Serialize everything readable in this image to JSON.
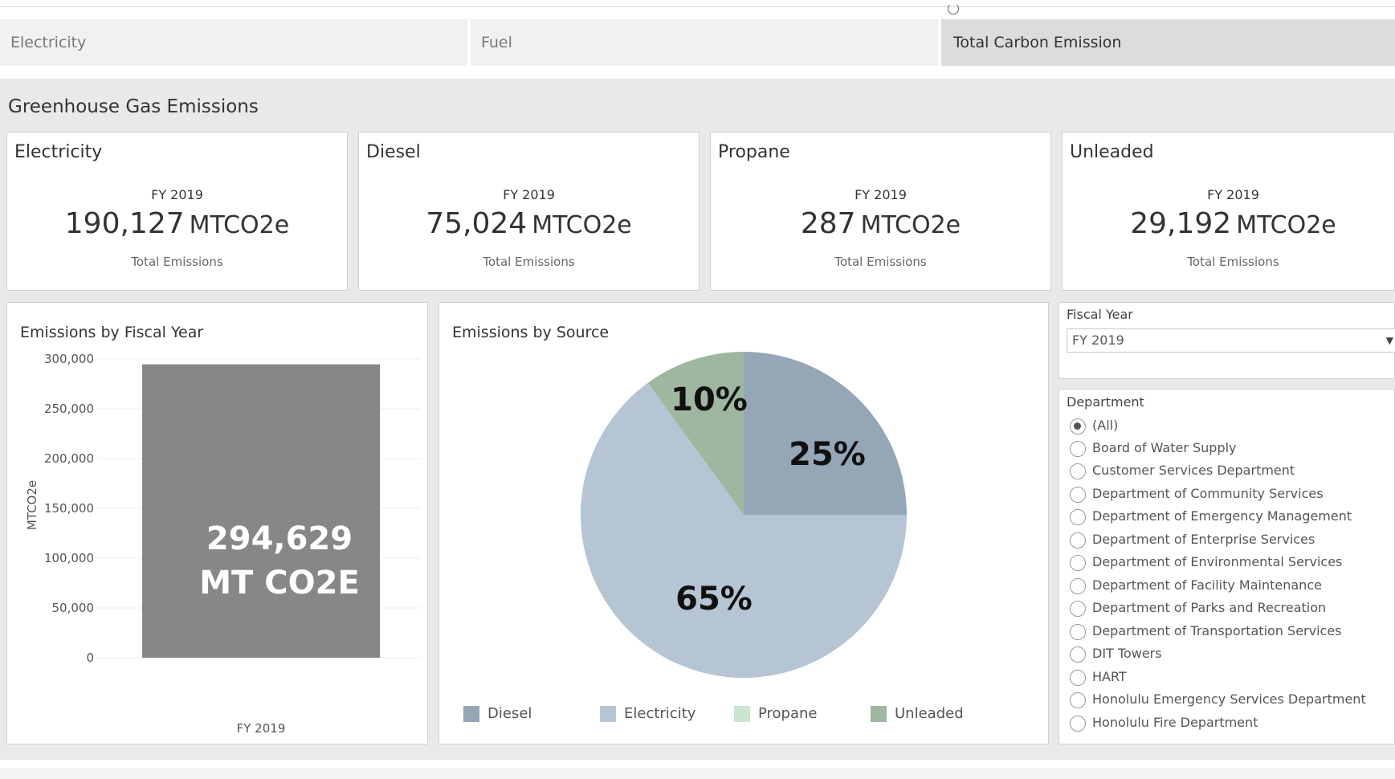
{
  "tabs": [
    {
      "label": "Electricity",
      "active": false
    },
    {
      "label": "Fuel",
      "active": false
    },
    {
      "label": "Total Carbon Emission",
      "active": true
    }
  ],
  "dashboard": {
    "title": "Greenhouse Gas Emissions",
    "kpis": [
      {
        "name": "Electricity",
        "fiscal_year": "FY 2019",
        "value": "190,127",
        "unit": "MTCO2e",
        "caption": "Total Emissions"
      },
      {
        "name": "Diesel",
        "fiscal_year": "FY 2019",
        "value": "75,024",
        "unit": "MTCO2e",
        "caption": "Total Emissions"
      },
      {
        "name": "Propane",
        "fiscal_year": "FY 2019",
        "value": "287",
        "unit": "MTCO2e",
        "caption": "Total Emissions"
      },
      {
        "name": "Unleaded",
        "fiscal_year": "FY 2019",
        "value": "29,192",
        "unit": "MTCO2e",
        "caption": "Total Emissions"
      }
    ]
  },
  "chart_data": [
    {
      "type": "bar",
      "title": "Emissions by Fiscal Year",
      "ylabel": "MTCO2e",
      "xlabel": "",
      "categories": [
        "FY 2019"
      ],
      "values": [
        294629
      ],
      "ylim": [
        0,
        300000
      ],
      "yticks": [
        "300,000",
        "250,000",
        "200,000",
        "150,000",
        "100,000",
        "50,000",
        "0"
      ],
      "bar_label_lines": [
        "294,629",
        "MT CO2E"
      ],
      "grid": true,
      "color": "#878787"
    },
    {
      "type": "pie",
      "title": "Emissions by Source",
      "slices": [
        {
          "name": "Diesel",
          "value": 25,
          "label": "25%",
          "color": "#95a6b6"
        },
        {
          "name": "Electricity",
          "value": 65,
          "label": "65%",
          "color": "#b5c5d3"
        },
        {
          "name": "Unleaded",
          "value": 10,
          "label": "10%",
          "color": "#9fb7a1"
        }
      ],
      "legend": [
        {
          "name": "Diesel",
          "color": "#95a6b6"
        },
        {
          "name": "Electricity",
          "color": "#b5c5d3"
        },
        {
          "name": "Propane",
          "color": "#c9e5cf"
        },
        {
          "name": "Unleaded",
          "color": "#9fb7a1"
        }
      ],
      "legend_position": "bottom"
    }
  ],
  "filters": {
    "fiscal_year": {
      "label": "Fiscal Year",
      "selected": "FY 2019"
    },
    "department": {
      "label": "Department",
      "selected": "(All)",
      "options": [
        "(All)",
        "Board of Water Supply",
        "Customer Services Department",
        "Department of Community Services",
        "Department of Emergency Management",
        "Department of Enterprise Services",
        "Department of Environmental Services",
        "Department of Facility Maintenance",
        "Department of Parks and Recreation",
        "Department of Transportation Services",
        "DIT Towers",
        "HART",
        "Honolulu Emergency Services Department",
        "Honolulu Fire Department"
      ]
    }
  }
}
